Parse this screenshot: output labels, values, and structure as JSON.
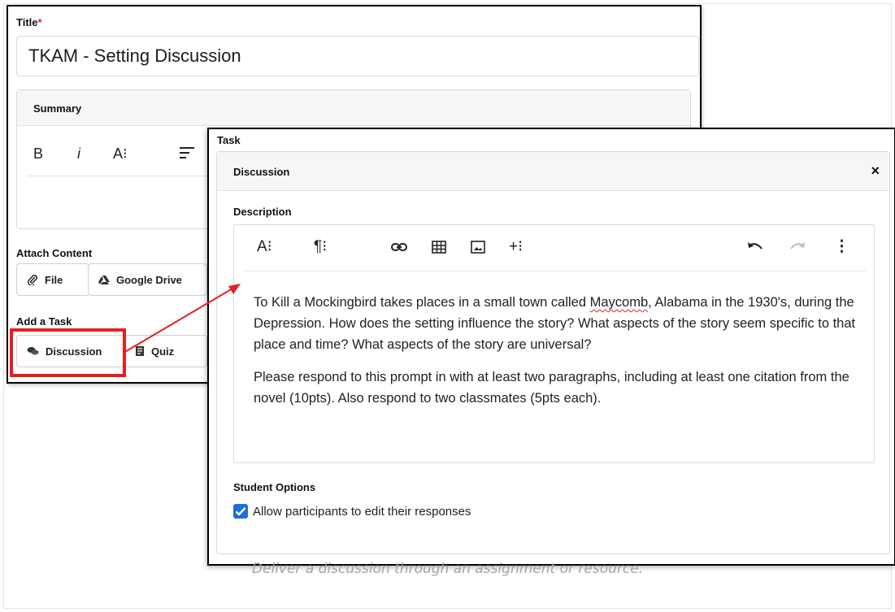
{
  "back": {
    "title_label": "Title",
    "required_mark": "*",
    "title_value": "TKAM - Setting Discussion",
    "summary_label": "Summary",
    "summary_toolbar": {
      "bold": "B",
      "italic": "i",
      "font": "A⁝"
    },
    "attach_label": "Attach Content",
    "attach_buttons": {
      "file": "File",
      "drive": "Google Drive"
    },
    "task_label": "Add a Task",
    "task_buttons": {
      "discussion": "Discussion",
      "quiz": "Quiz"
    }
  },
  "front": {
    "section_label": "Task",
    "card_title": "Discussion",
    "close": "×",
    "description_label": "Description",
    "toolbar": {
      "font": "A⁝",
      "paragraph": "¶⁝",
      "insert": "+⁝",
      "more": "⋮"
    },
    "paragraphs": {
      "p1_before": "To Kill a Mockingbird takes places in a small town called ",
      "p1_misspelled": "Maycomb",
      "p1_after": ", Alabama in the 1930's, during the Depression. How does the setting influence the story? What aspects of the story seem specific to that place and time? What aspects of the story are universal?",
      "p2": "Please respond to this prompt in with at least two paragraphs, including at least one citation from the novel (10pts). Also respond to two classmates (5pts each)."
    },
    "student_options_label": "Student Options",
    "allow_edit_label": "Allow participants to edit their responses",
    "allow_edit_checked": true
  },
  "caption": "Deliver a discussion through an assignment or resource.",
  "colors": {
    "highlight": "#e4201f",
    "checkbox": "#1f6fd6"
  }
}
